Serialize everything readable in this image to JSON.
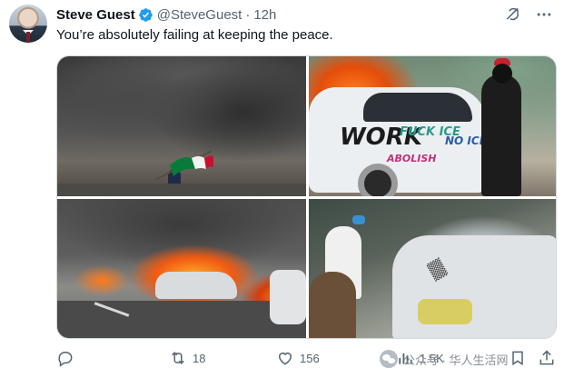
{
  "author": {
    "name": "Steve Guest",
    "handle": "@SteveGuest",
    "separator": "·",
    "time": "12h",
    "verified": true
  },
  "tweet": {
    "text": "You’re absolutely failing at keeping the peace."
  },
  "header_icons": [
    "grok-icon",
    "more-icon"
  ],
  "media": {
    "count": 4,
    "graffiti": [
      "WORK",
      "FUCK ICE",
      "ABOLISH",
      "NO ICE"
    ]
  },
  "actions": {
    "replies": "",
    "reposts": "18",
    "likes": "156",
    "views": "1.5K",
    "bookmark": "",
    "share": ""
  },
  "watermark": {
    "text": "公众号 · 华人生活网"
  },
  "colors": {
    "verified_blue": "#1d9bf0",
    "muted_text": "#536471",
    "border": "#cfd9de"
  }
}
